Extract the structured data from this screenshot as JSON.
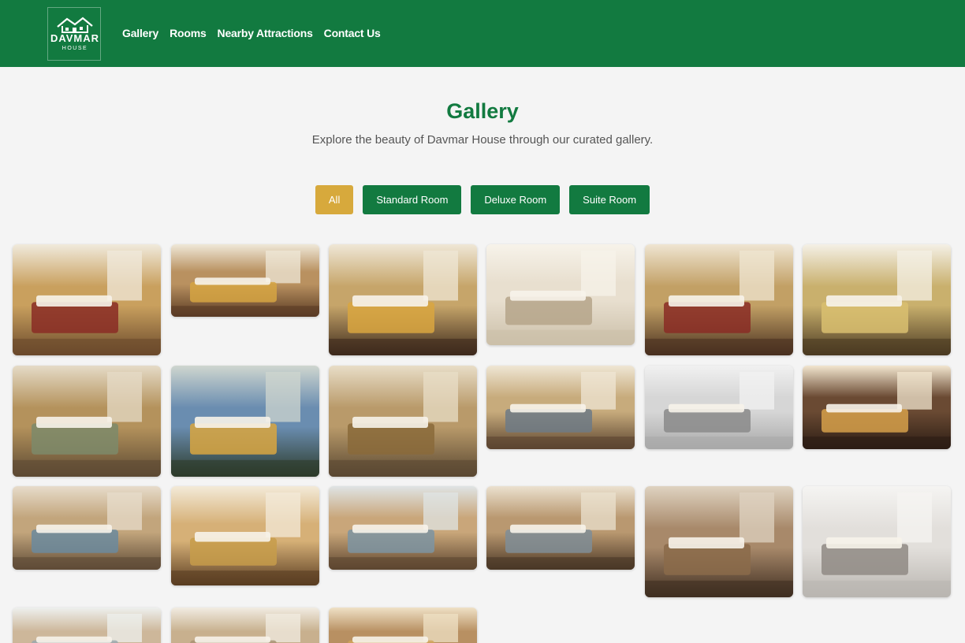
{
  "logo": {
    "name": "DAVMAR",
    "sub": "HOUSE"
  },
  "nav": [
    "Gallery",
    "Rooms",
    "Nearby Attractions",
    "Contact Us"
  ],
  "page": {
    "title": "Gallery",
    "subtitle": "Explore the beauty of Davmar House through our curated gallery."
  },
  "filters": [
    {
      "label": "All",
      "active": true
    },
    {
      "label": "Standard Room",
      "active": false
    },
    {
      "label": "Deluxe Room",
      "active": false
    },
    {
      "label": "Suite Room",
      "active": false
    }
  ],
  "colors": {
    "brand_green": "#127a40",
    "accent_gold": "#d7a93c",
    "background": "#f4f4f4"
  },
  "gallery": [
    {
      "scene": "bedroom-red-rug",
      "palette": [
        "#c9a05e",
        "#6b4a2c",
        "#f0eadc",
        "#8a2c25"
      ]
    },
    {
      "scene": "bedroom-twin-beds",
      "palette": [
        "#b99160",
        "#5a3b24",
        "#efe8d8",
        "#d6a542"
      ]
    },
    {
      "scene": "bedroom-tall-headboard",
      "palette": [
        "#c6a56a",
        "#3e2a1c",
        "#efe7d6",
        "#d9a63f"
      ]
    },
    {
      "scene": "bathroom-shower",
      "palette": [
        "#e8dfcf",
        "#cbbfa9",
        "#f7f3ea",
        "#b5a58a"
      ]
    },
    {
      "scene": "bedroom-window-curtains",
      "palette": [
        "#c2a065",
        "#4a3120",
        "#efe5d2",
        "#8a2c25"
      ]
    },
    {
      "scene": "bed-pillows-closeup",
      "palette": [
        "#c9b06d",
        "#4b3a22",
        "#f4f0e6",
        "#d9c070"
      ]
    },
    {
      "scene": "bedroom-lake-balcony",
      "palette": [
        "#b4925c",
        "#5d4a33",
        "#e5dbc7",
        "#7d8a6a"
      ]
    },
    {
      "scene": "balcony-lake-view",
      "palette": [
        "#6a8db0",
        "#2d3b2a",
        "#cfd6cf",
        "#d9a63f"
      ]
    },
    {
      "scene": "suite-sitting-area",
      "palette": [
        "#b99a6a",
        "#5a4832",
        "#e8ddc7",
        "#8a6a3a"
      ]
    },
    {
      "scene": "bedroom-with-tv",
      "palette": [
        "#c7ab7c",
        "#5b4430",
        "#efe6d4",
        "#6d7a86"
      ]
    },
    {
      "scene": "bathroom-marble-grey",
      "palette": [
        "#d6d6d6",
        "#a9a9a9",
        "#f1f1f1",
        "#8a8a8a"
      ]
    },
    {
      "scene": "bathroom-dark-vanity",
      "palette": [
        "#6a4a33",
        "#2c1d14",
        "#f2e6cf",
        "#d6a04a"
      ]
    },
    {
      "scene": "bedroom-mountain-view",
      "palette": [
        "#c2a57c",
        "#5f4b37",
        "#e7dccb",
        "#6b8a9e"
      ]
    },
    {
      "scene": "bedroom-bright-gold",
      "palette": [
        "#d6b077",
        "#5a3d22",
        "#f3ead8",
        "#c79c4a"
      ]
    },
    {
      "scene": "window-lake-view",
      "palette": [
        "#c9a67a",
        "#5d4630",
        "#dfe4e4",
        "#7c94a2"
      ]
    },
    {
      "scene": "bedroom-fireplace-tv",
      "palette": [
        "#b99870",
        "#4a3726",
        "#ebe1cf",
        "#7f8d96"
      ]
    },
    {
      "scene": "suite-tartan-carpet",
      "palette": [
        "#a8896a",
        "#3f2e21",
        "#dfd3c1",
        "#8b6b4a"
      ]
    },
    {
      "scene": "bathroom-freestanding-tub",
      "palette": [
        "#e2dfdb",
        "#b9b5b0",
        "#f5f4f2",
        "#8f8a84"
      ]
    },
    {
      "scene": "room-window-bright",
      "palette": [
        "#cdb79a",
        "#6a5540",
        "#eef0ee",
        "#9aa8ad"
      ]
    },
    {
      "scene": "room-ceiling-ac",
      "palette": [
        "#c8b08e",
        "#76604a",
        "#f1ece2",
        "#a89373"
      ]
    },
    {
      "scene": "bedroom-headboard-lamps",
      "palette": [
        "#b89062",
        "#4a321f",
        "#efe1c6",
        "#d0a35a"
      ]
    }
  ]
}
